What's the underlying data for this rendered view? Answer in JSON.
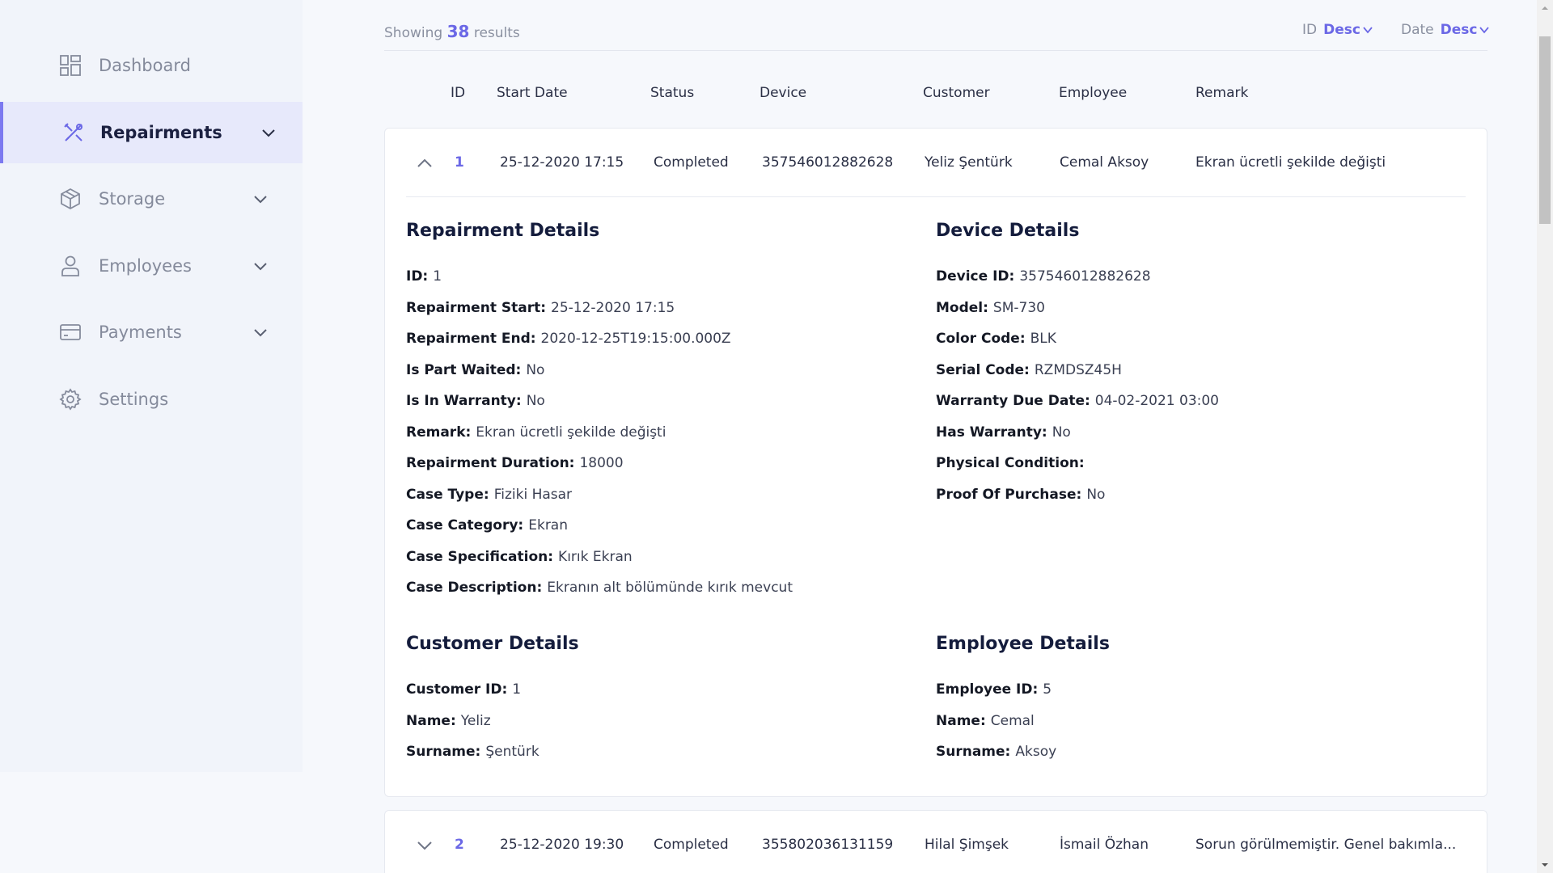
{
  "sidebar": {
    "items": [
      {
        "label": "Dashboard",
        "icon": "dashboard-icon"
      },
      {
        "label": "Repairments",
        "icon": "tools-icon"
      },
      {
        "label": "Storage",
        "icon": "box-icon"
      },
      {
        "label": "Employees",
        "icon": "user-icon"
      },
      {
        "label": "Payments",
        "icon": "credit-card-icon"
      },
      {
        "label": "Settings",
        "icon": "gear-icon"
      }
    ]
  },
  "topbar": {
    "showing": "Showing",
    "count": "38",
    "results": "results",
    "sort_id_label": "ID",
    "sort_id_value": "Desc",
    "sort_date_label": "Date",
    "sort_date_value": "Desc"
  },
  "columns": [
    "ID",
    "Start Date",
    "Status",
    "Device",
    "Customer",
    "Employee",
    "Remark"
  ],
  "rows": [
    {
      "id": "1",
      "start_date": "25-12-2020 17:15",
      "status": "Completed",
      "device": "357546012882628",
      "customer": "Yeliz Şentürk",
      "employee": "Cemal Aksoy",
      "remark": "Ekran ücretli şekilde değişti"
    },
    {
      "id": "2",
      "start_date": "25-12-2020 19:30",
      "status": "Completed",
      "device": "355802036131159",
      "customer": "Hilal Şimşek",
      "employee": "İsmail Özhan",
      "remark": "Sorun görülmemiştir. Genel bakımla..."
    }
  ],
  "details": {
    "repairment": {
      "title": "Repairment Details",
      "fields": [
        {
          "label": "ID:",
          "value": "1"
        },
        {
          "label": "Repairment Start:",
          "value": "25-12-2020 17:15"
        },
        {
          "label": "Repairment End:",
          "value": "2020-12-25T19:15:00.000Z"
        },
        {
          "label": "Is Part Waited:",
          "value": "No"
        },
        {
          "label": "Is In Warranty:",
          "value": "No"
        },
        {
          "label": "Remark:",
          "value": "Ekran ücretli şekilde değişti"
        },
        {
          "label": "Repairment Duration:",
          "value": "18000"
        },
        {
          "label": "Case Type:",
          "value": "Fiziki Hasar"
        },
        {
          "label": "Case Category:",
          "value": "Ekran"
        },
        {
          "label": "Case Specification:",
          "value": "Kırık Ekran"
        },
        {
          "label": "Case Description:",
          "value": "Ekranın alt bölümünde kırık mevcut"
        }
      ]
    },
    "device": {
      "title": "Device Details",
      "fields": [
        {
          "label": "Device ID:",
          "value": "357546012882628"
        },
        {
          "label": "Model:",
          "value": "SM-730"
        },
        {
          "label": "Color Code:",
          "value": "BLK"
        },
        {
          "label": "Serial Code:",
          "value": "RZMDSZ45H"
        },
        {
          "label": "Warranty Due Date:",
          "value": "04-02-2021 03:00"
        },
        {
          "label": "Has Warranty:",
          "value": "No"
        },
        {
          "label": "Physical Condition:",
          "value": ""
        },
        {
          "label": "Proof Of Purchase:",
          "value": "No"
        }
      ]
    },
    "customer": {
      "title": "Customer Details",
      "fields": [
        {
          "label": "Customer ID:",
          "value": "1"
        },
        {
          "label": "Name:",
          "value": "Yeliz"
        },
        {
          "label": "Surname:",
          "value": "Şentürk"
        }
      ]
    },
    "employee": {
      "title": "Employee Details",
      "fields": [
        {
          "label": "Employee ID:",
          "value": "5"
        },
        {
          "label": "Name:",
          "value": "Cemal"
        },
        {
          "label": "Surname:",
          "value": "Aksoy"
        }
      ]
    }
  },
  "colors": {
    "accent": "#6b68e6",
    "sidebar_bg": "#f1f4fa",
    "active_bg": "#e7e9fb"
  }
}
